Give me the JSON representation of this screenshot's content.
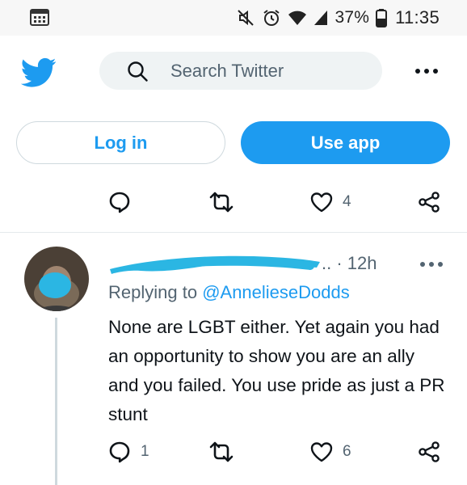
{
  "status_bar": {
    "battery_percent": "37%",
    "time": "11:35"
  },
  "header": {
    "logo_icon": "twitter-bird-icon",
    "search_placeholder": "Search Twitter",
    "more_icon": "more-horizontal-icon"
  },
  "auth": {
    "login_label": "Log in",
    "use_app_label": "Use app"
  },
  "previous_tweet_actions": {
    "like_count": "4"
  },
  "reply": {
    "time_meta": ".. · 12h",
    "replying_prefix": "Replying to ",
    "replying_handle": "@AnnelieseDodds",
    "text": "None are LGBT either. Yet again you had an opportunity to show you are an ally and you failed. You use pride as just a PR stunt",
    "reply_count": "1",
    "like_count": "6"
  },
  "colors": {
    "accent": "#1d9bf0",
    "secondary_text": "#536471",
    "redaction": "#2bb6e3"
  }
}
